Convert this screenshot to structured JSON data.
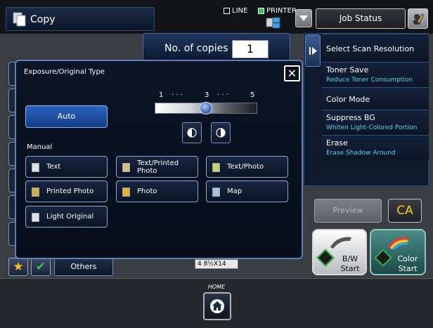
{
  "header": {
    "app_title": "Copy",
    "mode_line": "LINE",
    "mode_printer": "PRINTER",
    "job_status": "Job Status"
  },
  "main": {
    "copies_label": "No. of copies",
    "copies_value": "1",
    "paper_indicator": "4  8½X14"
  },
  "right_panel": {
    "items": [
      {
        "title": "Select Scan Resolution",
        "subtitle": ""
      },
      {
        "title": "Toner Save",
        "subtitle": "Reduce Toner Consumption"
      },
      {
        "title": "Color Mode",
        "subtitle": ""
      },
      {
        "title": "Suppress BG",
        "subtitle": "Whiten Light-Colored Portion"
      },
      {
        "title": "Erase",
        "subtitle": "Erase Shadow Around"
      }
    ],
    "preview": "Preview",
    "ca": "CA",
    "bw_start": "B/W\nStart",
    "color_start": "Color\nStart"
  },
  "bottom": {
    "others": "Others",
    "home": "HOME"
  },
  "dialog": {
    "title": "Exposure/Original Type",
    "auto": "Auto",
    "scale_1": "1",
    "scale_3": "3",
    "scale_5": "5",
    "scale_dots": "·  ·  ·",
    "exposure_level": 3,
    "manual_label": "Manual",
    "options": [
      {
        "label": "Text"
      },
      {
        "label": "Text/Printed\nPhoto"
      },
      {
        "label": "Text/Photo"
      },
      {
        "label": "Printed Photo"
      },
      {
        "label": "Photo"
      },
      {
        "label": "Map"
      },
      {
        "label": "Light Original"
      }
    ]
  },
  "colors": {
    "accent_blue": "#2a63bf",
    "start_green": "#2db34a",
    "ca_yellow": "#f6cf1a",
    "subtitle_cyan": "#5fd0f0"
  }
}
